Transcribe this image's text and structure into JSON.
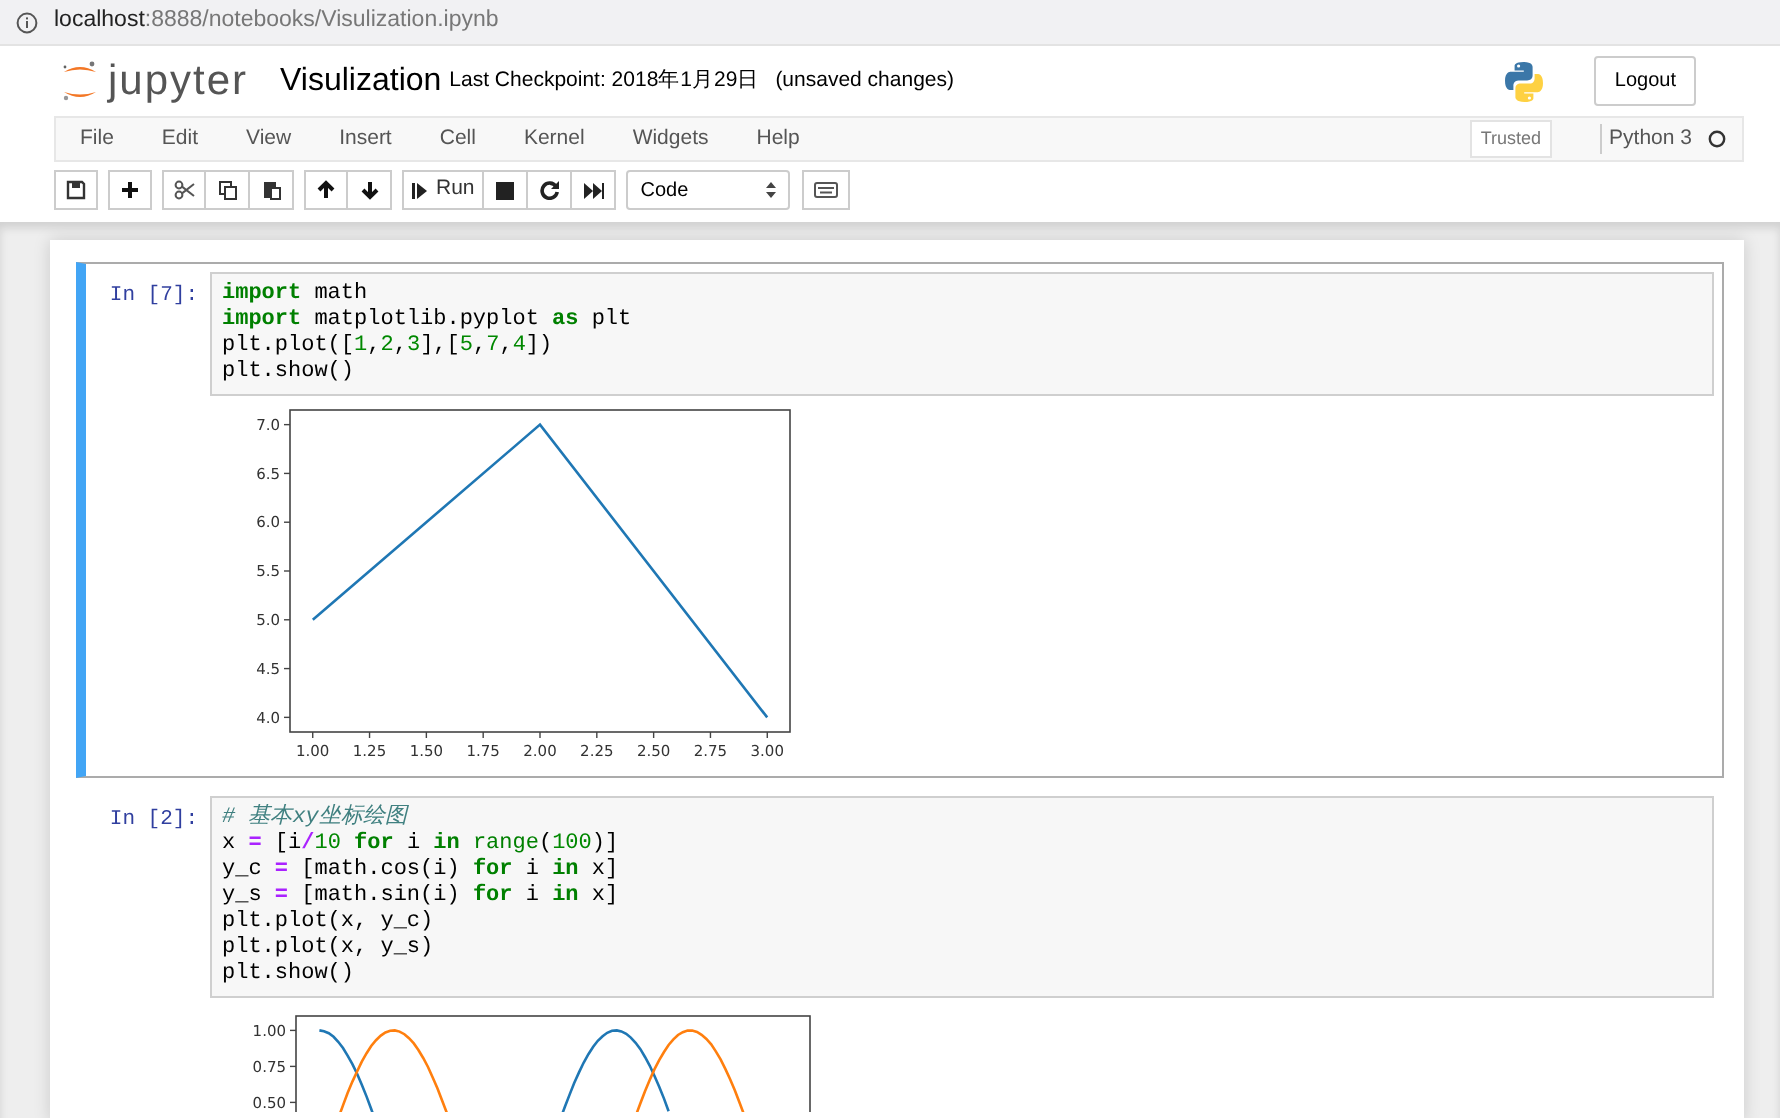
{
  "address_bar": {
    "host": "localhost",
    "path": ":8888/notebooks/Visulization.ipynb"
  },
  "header": {
    "logo_text": "jupyter",
    "title": "Visulization",
    "checkpoint": "Last Checkpoint: 2018年1月29日",
    "unsaved": "(unsaved changes)",
    "logout": "Logout"
  },
  "menu": [
    "File",
    "Edit",
    "View",
    "Insert",
    "Cell",
    "Kernel",
    "Widgets",
    "Help"
  ],
  "status": {
    "trusted": "Trusted",
    "kernel": "Python 3"
  },
  "toolbar": {
    "run_label": "Run",
    "cell_type": "Code"
  },
  "cells": [
    {
      "prompt": "In [7]:",
      "selected": true,
      "code": [
        [
          {
            "text": "import",
            "kind": "keyword"
          },
          {
            "text": " math",
            "kind": "plain"
          }
        ],
        [
          {
            "text": "import",
            "kind": "keyword"
          },
          {
            "text": " matplotlib.pyplot ",
            "kind": "plain"
          },
          {
            "text": "as",
            "kind": "keyword"
          },
          {
            "text": " plt",
            "kind": "plain"
          }
        ],
        [
          {
            "text": "plt.plot([",
            "kind": "plain"
          },
          {
            "text": "1",
            "kind": "number"
          },
          {
            "text": ",",
            "kind": "plain"
          },
          {
            "text": "2",
            "kind": "number"
          },
          {
            "text": ",",
            "kind": "plain"
          },
          {
            "text": "3",
            "kind": "number"
          },
          {
            "text": "],[",
            "kind": "plain"
          },
          {
            "text": "5",
            "kind": "number"
          },
          {
            "text": ",",
            "kind": "plain"
          },
          {
            "text": "7",
            "kind": "number"
          },
          {
            "text": ",",
            "kind": "plain"
          },
          {
            "text": "4",
            "kind": "number"
          },
          {
            "text": "])",
            "kind": "plain"
          }
        ],
        [
          {
            "text": "plt.show()",
            "kind": "plain"
          }
        ]
      ],
      "output": {
        "kind": "chart",
        "chart_data": {
          "type": "line",
          "x": [
            1,
            2,
            3
          ],
          "series": [
            {
              "color": "#1f77b4",
              "values": [
                5,
                7,
                4
              ]
            }
          ],
          "xlim": [
            0.9,
            3.1
          ],
          "ylim": [
            3.85,
            7.15
          ],
          "xticks": [
            {
              "value": 1,
              "label": "1.00"
            },
            {
              "value": 1.25,
              "label": "1.25"
            },
            {
              "value": 1.5,
              "label": "1.50"
            },
            {
              "value": 1.75,
              "label": "1.75"
            },
            {
              "value": 2,
              "label": "2.00"
            },
            {
              "value": 2.25,
              "label": "2.25"
            },
            {
              "value": 2.5,
              "label": "2.50"
            },
            {
              "value": 2.75,
              "label": "2.75"
            },
            {
              "value": 3,
              "label": "3.00"
            }
          ],
          "yticks": [
            {
              "value": 4,
              "label": "4.0"
            },
            {
              "value": 4.5,
              "label": "4.5"
            },
            {
              "value": 5,
              "label": "5.0"
            },
            {
              "value": 5.5,
              "label": "5.5"
            },
            {
              "value": 6,
              "label": "6.0"
            },
            {
              "value": 6.5,
              "label": "6.5"
            },
            {
              "value": 7,
              "label": "7.0"
            }
          ]
        }
      }
    },
    {
      "prompt": "In [2]:",
      "selected": false,
      "code": [
        [
          {
            "text": "# 基本xy坐标绘图",
            "kind": "comment"
          }
        ],
        [
          {
            "text": "x ",
            "kind": "plain"
          },
          {
            "text": "=",
            "kind": "operator"
          },
          {
            "text": " [i",
            "kind": "plain"
          },
          {
            "text": "/",
            "kind": "operator"
          },
          {
            "text": "10",
            "kind": "number"
          },
          {
            "text": " for",
            "kind": "keyword"
          },
          {
            "text": " i ",
            "kind": "plain"
          },
          {
            "text": "in",
            "kind": "keyword"
          },
          {
            "text": " range",
            "kind": "builtin"
          },
          {
            "text": "(",
            "kind": "plain"
          },
          {
            "text": "100",
            "kind": "number"
          },
          {
            "text": ")]",
            "kind": "plain"
          }
        ],
        [
          {
            "text": "y_c ",
            "kind": "plain"
          },
          {
            "text": "=",
            "kind": "operator"
          },
          {
            "text": " [math.cos(i) ",
            "kind": "plain"
          },
          {
            "text": "for",
            "kind": "keyword"
          },
          {
            "text": " i ",
            "kind": "plain"
          },
          {
            "text": "in",
            "kind": "keyword"
          },
          {
            "text": " x]",
            "kind": "plain"
          }
        ],
        [
          {
            "text": "y_s ",
            "kind": "plain"
          },
          {
            "text": "=",
            "kind": "operator"
          },
          {
            "text": " [math.sin(i) ",
            "kind": "plain"
          },
          {
            "text": "for",
            "kind": "keyword"
          },
          {
            "text": " i ",
            "kind": "plain"
          },
          {
            "text": "in",
            "kind": "keyword"
          },
          {
            "text": " x]",
            "kind": "plain"
          }
        ],
        [
          {
            "text": "plt.plot(x, y_c)",
            "kind": "plain"
          }
        ],
        [
          {
            "text": "plt.plot(x, y_s)",
            "kind": "plain"
          }
        ],
        [
          {
            "text": "plt.show()",
            "kind": "plain"
          }
        ]
      ],
      "output": {
        "kind": "wave_picture",
        "ytick_labels": [
          "1.00",
          "0.75",
          "0.50"
        ]
      }
    }
  ]
}
